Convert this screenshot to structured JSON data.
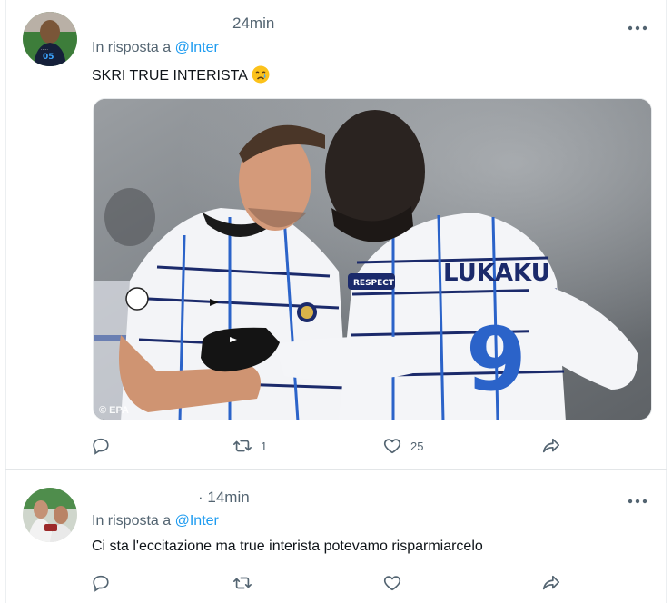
{
  "tweets": [
    {
      "timestamp": "24min",
      "reply_prefix": "In risposta a",
      "reply_to": "@Inter",
      "text": "SKRI TRUE INTERISTA",
      "emoji": "crying-face-emoji",
      "media": {
        "watermark": "© EPA",
        "jersey_text": "LUKAKU",
        "jersey_number": "9",
        "sleeve_patch": "RESPECT"
      },
      "actions": {
        "reply_count": "",
        "retweet_count": "1",
        "like_count": "25"
      }
    },
    {
      "timestamp": "· 14min",
      "reply_prefix": "In risposta a",
      "reply_to": "@Inter",
      "text": "Ci sta l'eccitazione ma true interista potevamo risparmiarcelo",
      "actions": {
        "reply_count": "",
        "retweet_count": "",
        "like_count": ""
      }
    }
  ],
  "colors": {
    "accent": "#1d9bf0",
    "secondary_text": "#536471",
    "primary_text": "#0f1419",
    "divider": "#e3e6e8"
  },
  "icons": [
    "more-icon",
    "reply-icon",
    "retweet-icon",
    "like-icon",
    "share-icon"
  ]
}
